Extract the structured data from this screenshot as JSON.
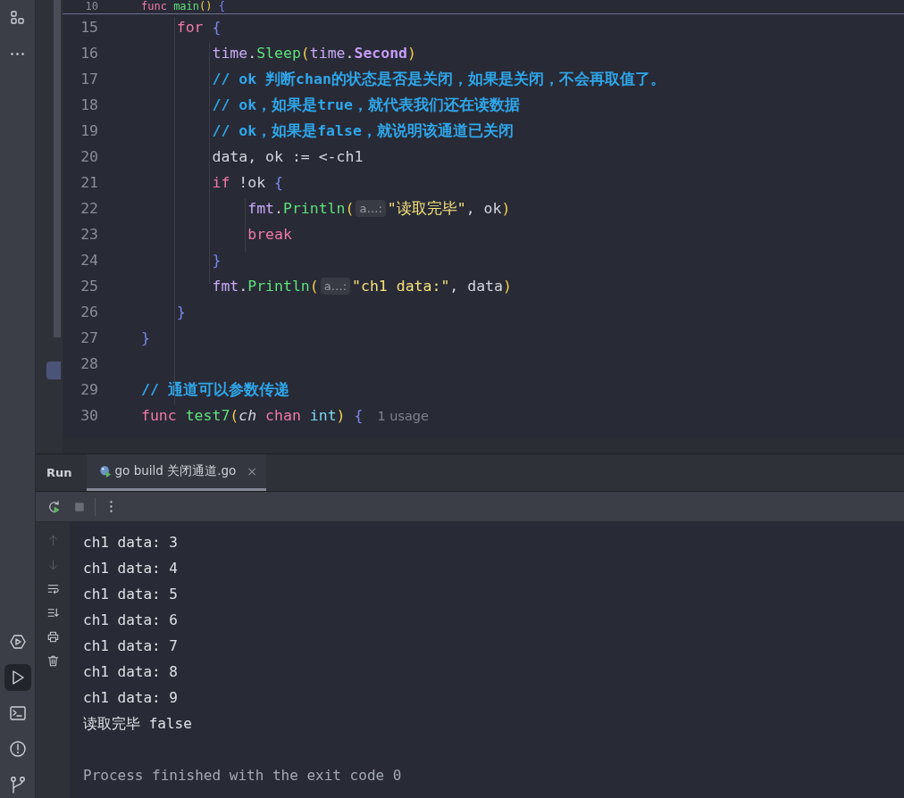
{
  "left_toolbar": {
    "top": [
      {
        "kind": "structure",
        "selected": false
      },
      {
        "kind": "more",
        "selected": false
      }
    ],
    "bottom": [
      {
        "kind": "services",
        "selected": false
      },
      {
        "kind": "run",
        "selected": true
      },
      {
        "kind": "terminal",
        "selected": false
      },
      {
        "kind": "problems",
        "selected": false
      },
      {
        "kind": "git",
        "selected": false
      }
    ]
  },
  "editor": {
    "sticky": {
      "number": "10",
      "tokens": [
        {
          "kind": "kw",
          "text": "func"
        },
        {
          "kind": "fn",
          "text": " main"
        },
        {
          "kind": "paren",
          "text": "()"
        },
        {
          "kind": "brace",
          "text": " {"
        }
      ]
    },
    "lines": [
      {
        "number": "15",
        "tokens": [
          {
            "kind": "kw",
            "text": "    for"
          },
          {
            "kind": "brace",
            "text": " {"
          }
        ]
      },
      {
        "number": "16",
        "tokens": [
          {
            "kind": "pkg",
            "text": "        time"
          },
          {
            "kind": "plain",
            "text": "."
          },
          {
            "kind": "fn",
            "text": "Sleep"
          },
          {
            "kind": "paren",
            "text": "("
          },
          {
            "kind": "pkg",
            "text": "time"
          },
          {
            "kind": "plain",
            "text": "."
          },
          {
            "kind": "const",
            "text": "Second"
          },
          {
            "kind": "paren",
            "text": ")"
          }
        ]
      },
      {
        "number": "17",
        "tokens": [
          {
            "kind": "cm",
            "text": "        // ok 判断chan的状态是否是关闭，如果是关闭，不会再取值了。"
          }
        ]
      },
      {
        "number": "18",
        "tokens": [
          {
            "kind": "cm",
            "text": "        // ok，如果是true，就代表我们还在读数据"
          }
        ]
      },
      {
        "number": "19",
        "tokens": [
          {
            "kind": "cm",
            "text": "        // ok，如果是false，就说明该通道已关闭"
          }
        ]
      },
      {
        "number": "20",
        "tokens": [
          {
            "kind": "plain",
            "text": "        data, ok := <-ch1"
          }
        ]
      },
      {
        "number": "21",
        "tokens": [
          {
            "kind": "kw",
            "text": "        if"
          },
          {
            "kind": "plain",
            "text": " !ok"
          },
          {
            "kind": "brace",
            "text": " {"
          }
        ]
      },
      {
        "number": "22",
        "tokens": [
          {
            "kind": "pkg",
            "text": "            fmt"
          },
          {
            "kind": "plain",
            "text": "."
          },
          {
            "kind": "fn",
            "text": "Println"
          },
          {
            "kind": "paren",
            "text": "("
          },
          {
            "kind": "hint",
            "text": "a…:"
          },
          {
            "kind": "str",
            "text": "\"读取完毕\""
          },
          {
            "kind": "plain",
            "text": ", ok"
          },
          {
            "kind": "paren",
            "text": ")"
          }
        ]
      },
      {
        "number": "23",
        "tokens": [
          {
            "kind": "kw",
            "text": "            break"
          }
        ]
      },
      {
        "number": "24",
        "tokens": [
          {
            "kind": "brace",
            "text": "        }"
          }
        ]
      },
      {
        "number": "25",
        "tokens": [
          {
            "kind": "pkg",
            "text": "        fmt"
          },
          {
            "kind": "plain",
            "text": "."
          },
          {
            "kind": "fn",
            "text": "Println"
          },
          {
            "kind": "paren",
            "text": "("
          },
          {
            "kind": "hint",
            "text": "a…:"
          },
          {
            "kind": "str",
            "text": "\"ch1 data:\""
          },
          {
            "kind": "plain",
            "text": ", data"
          },
          {
            "kind": "paren",
            "text": ")"
          }
        ]
      },
      {
        "number": "26",
        "tokens": [
          {
            "kind": "brace",
            "text": "    }"
          }
        ]
      },
      {
        "number": "27",
        "tokens": [
          {
            "kind": "brace",
            "text": "}"
          }
        ]
      },
      {
        "number": "28"
      },
      {
        "number": "29",
        "tokens": [
          {
            "kind": "cm",
            "text": "// 通道可以参数传递"
          }
        ]
      },
      {
        "number": "30",
        "tokens": [
          {
            "kind": "kw",
            "text": "func"
          },
          {
            "kind": "fn",
            "text": " test7"
          },
          {
            "kind": "paren",
            "text": "("
          },
          {
            "kind": "param",
            "text": "ch"
          },
          {
            "kind": "kw",
            "text": " chan"
          },
          {
            "kind": "type",
            "text": " int"
          },
          {
            "kind": "paren",
            "text": ")"
          },
          {
            "kind": "brace",
            "text": " {"
          },
          {
            "kind": "usage",
            "text": "1 usage"
          }
        ]
      }
    ]
  },
  "run_panel": {
    "title": "Run",
    "tabs": [
      {
        "label": "go build 关闭通道.go",
        "close": "×",
        "selected": true
      }
    ],
    "toolbar": [
      {
        "kind": "rerun",
        "disabled": false
      },
      {
        "kind": "stop",
        "disabled": true
      },
      {
        "kind": "more",
        "disabled": false
      }
    ],
    "side_actions": [
      {
        "kind": "up",
        "disabled": true
      },
      {
        "kind": "down",
        "disabled": true
      },
      {
        "kind": "wrap",
        "disabled": false
      },
      {
        "kind": "scroll-end",
        "disabled": false
      },
      {
        "kind": "print",
        "disabled": false
      },
      {
        "kind": "trash",
        "disabled": false
      }
    ],
    "output": [
      {
        "kind": "stdout",
        "text": "ch1 data: 3"
      },
      {
        "kind": "stdout",
        "text": "ch1 data: 4"
      },
      {
        "kind": "stdout",
        "text": "ch1 data: 5"
      },
      {
        "kind": "stdout",
        "text": "ch1 data: 6"
      },
      {
        "kind": "stdout",
        "text": "ch1 data: 7"
      },
      {
        "kind": "stdout",
        "text": "ch1 data: 8"
      },
      {
        "kind": "stdout",
        "text": "ch1 data: 9"
      },
      {
        "kind": "stdout",
        "text": "读取完毕 false"
      },
      {
        "kind": "blank"
      },
      {
        "kind": "system",
        "text": "Process finished with the exit code 0"
      }
    ]
  }
}
